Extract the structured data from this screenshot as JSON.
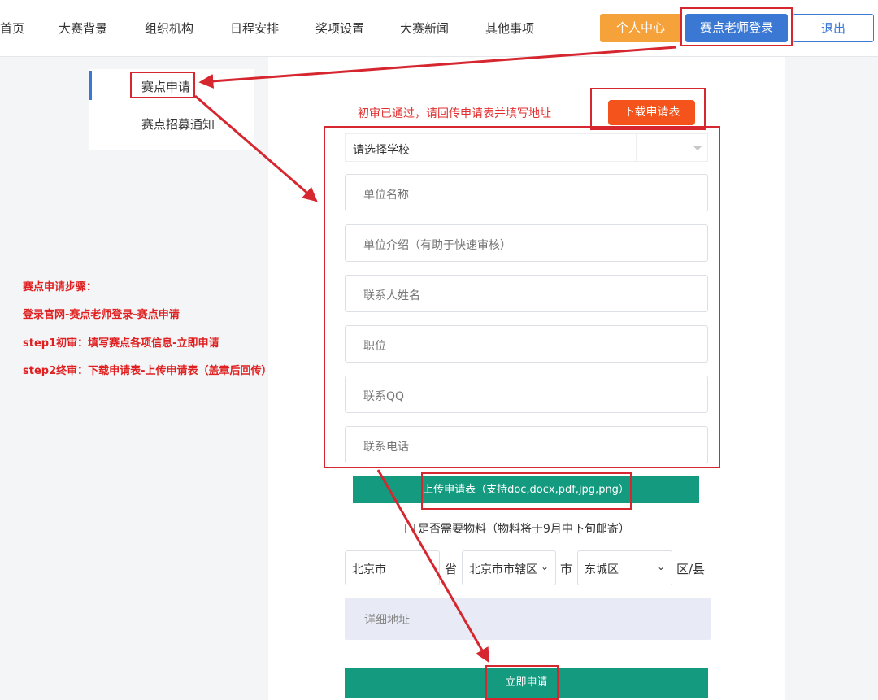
{
  "nav": {
    "items": [
      "首页",
      "大赛背景",
      "组织机构",
      "日程安排",
      "奖项设置",
      "大赛新闻",
      "其他事项"
    ],
    "personal_center": "个人中心",
    "teacher_login": "赛点老师登录",
    "logout": "退出"
  },
  "sidebar": {
    "items": [
      "赛点申请",
      "赛点招募通知"
    ]
  },
  "notice": "初审已通过，请回传申请表并填写地址",
  "download_button": "下载申请表",
  "form": {
    "school_select": "请选择学校",
    "fields": [
      "单位名称",
      "单位介绍（有助于快速审核）",
      "联系人姓名",
      "职位",
      "联系QQ",
      "联系电话"
    ],
    "upload_button": "上传申请表（支持doc,docx,pdf,jpg,png）",
    "materials_checkbox": "是否需要物料（物料将于9月中下旬邮寄）",
    "province": "北京市",
    "province_unit": "省",
    "city": "北京市市辖区",
    "city_unit": "市",
    "district": "东城区",
    "district_unit": "区/县",
    "address_placeholder": "详细地址",
    "submit_button": "立即申请"
  },
  "steps": [
    "赛点申请步骤：",
    "登录官网-赛点老师登录-赛点申请",
    "step1初审：填写赛点各项信息-立即申请",
    "step2终审：下载申请表-上传申请表（盖章后回传）"
  ],
  "colors": {
    "accent_blue": "#3a78d4",
    "orange": "#f6a23b",
    "download_orange": "#f4541c",
    "green": "#149a7e",
    "annotation_red": "#d6262f"
  }
}
